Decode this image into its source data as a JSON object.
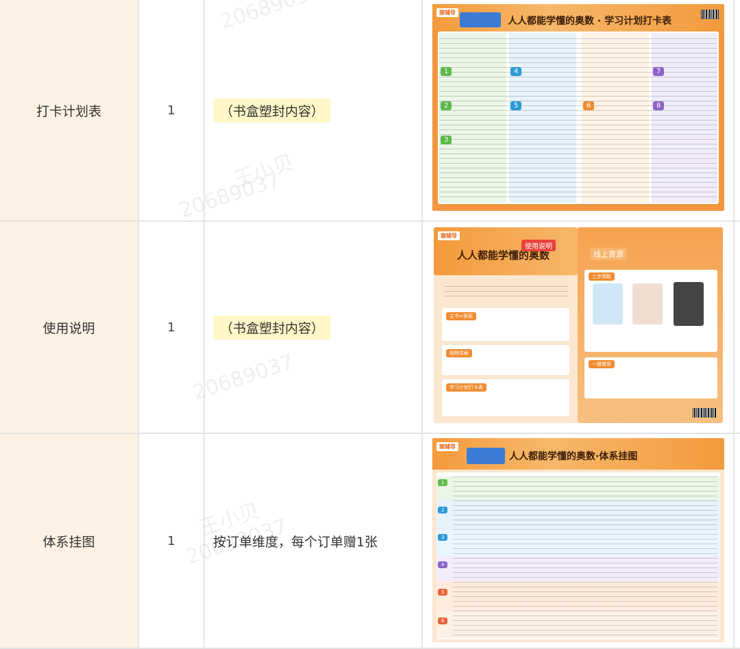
{
  "rows": [
    {
      "name": "打卡计划表",
      "qty": "1",
      "note": "（书盒塑封内容）",
      "note_highlight": true,
      "image": {
        "logo": "猿辅导",
        "title": "人人都能学懂的奥数 · 学习计划打卡表",
        "watermark_1": "20689037",
        "watermark_2": "王小贝",
        "watermark_3": "20689037"
      }
    },
    {
      "name": "使用说明",
      "qty": "1",
      "note": "（书盒塑封内容）",
      "note_highlight": true,
      "image": {
        "logo": "猿辅导",
        "title": "人人都能学懂的奥数",
        "badge": "使用说明",
        "right_title": "线上资源",
        "sections": [
          "主书+答案",
          "视频讲解",
          "学习计划打卡表"
        ],
        "right_sections": [
          "三步领取",
          "一键使用"
        ],
        "watermark_1": "王小贝",
        "watermark_2": "20689037"
      }
    },
    {
      "name": "体系挂图",
      "qty": "1",
      "note": "按订单维度，每个订单赠1张",
      "note_highlight": false,
      "image": {
        "logo": "猿辅导",
        "title": "人人都能学懂的奥数·体系挂图",
        "watermark_1": "王小贝",
        "watermark_2": "20689037",
        "watermark_3": "20689037"
      }
    }
  ],
  "colors": {
    "name_cell_bg": "#fdf2e3",
    "highlight_bg": "#fff7c8",
    "accent_orange": "#f08b2f"
  }
}
